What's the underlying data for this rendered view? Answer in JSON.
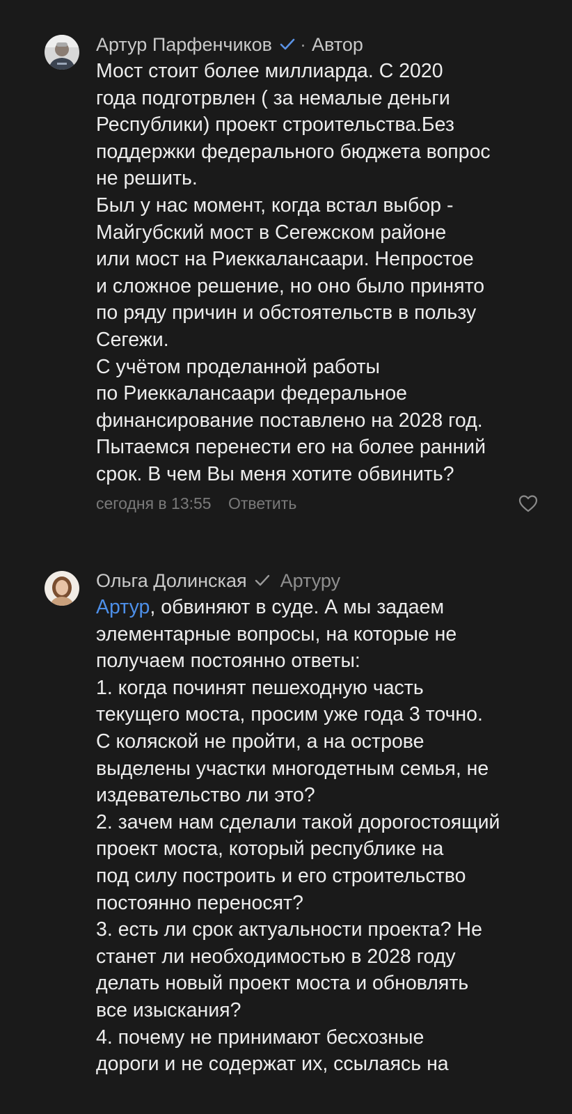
{
  "comments": [
    {
      "author": "Артур Парфенчиков",
      "separator": "·",
      "role": "Автор",
      "text": "Мост стоит более миллиарда. С 2020\nгода подготрвлен ( за немалые деньги\nРеспублики) проект строительства.Без\nподдержки федерального бюджета вопрос\nне решить.\nБыл у нас момент, когда встал выбор -\nМайгубский мост в Сегежском районе\nили мост на Риеккалансаари. Непростое\nи сложное решение, но оно было принято\nпо ряду причин и обстоятельств в пользу\nСегежи.\nС учётом проделанной работы\nпо Риеккалансаари федеральное\nфинансирование поставлено на 2028 год.\nПытаемся перенести его на более ранний\nсрок. В чем Вы меня хотите обвинить?",
      "time": "сегодня в 13:55",
      "reply_label": "Ответить",
      "avatar_icon": "person-photo",
      "verified_color": "#5b93e6"
    },
    {
      "author": "Ольга Долинская",
      "reply_to": "Артуру",
      "mention": "Артур",
      "text": ", обвиняют в суде. А мы задаем\nэлементарные вопросы, на которые не\nполучаем постоянно ответы:\n1. когда починят пешеходную часть\nтекущего моста, просим уже года 3 точно.\nС коляской не пройти, а на острове\nвыделены участки многодетным семья, не\nиздевательство ли это?\n2. зачем нам сделали такой дорогостоящий\nпроект моста, который республике на\nпод силу построить и его строительство\nпостоянно переносят?\n3. есть ли срок актуальности проекта? Не\nстанет ли необходимостью в 2028 году\nделать новый проект моста и обновлять\nвсе изыскания?\n4. почему не принимают бесхозные\nдороги и не содержат их, ссылаясь на",
      "avatar_icon": "person-photo",
      "verified_color": "#9a9a9a",
      "mention_color": "#4d8fe8"
    }
  ]
}
